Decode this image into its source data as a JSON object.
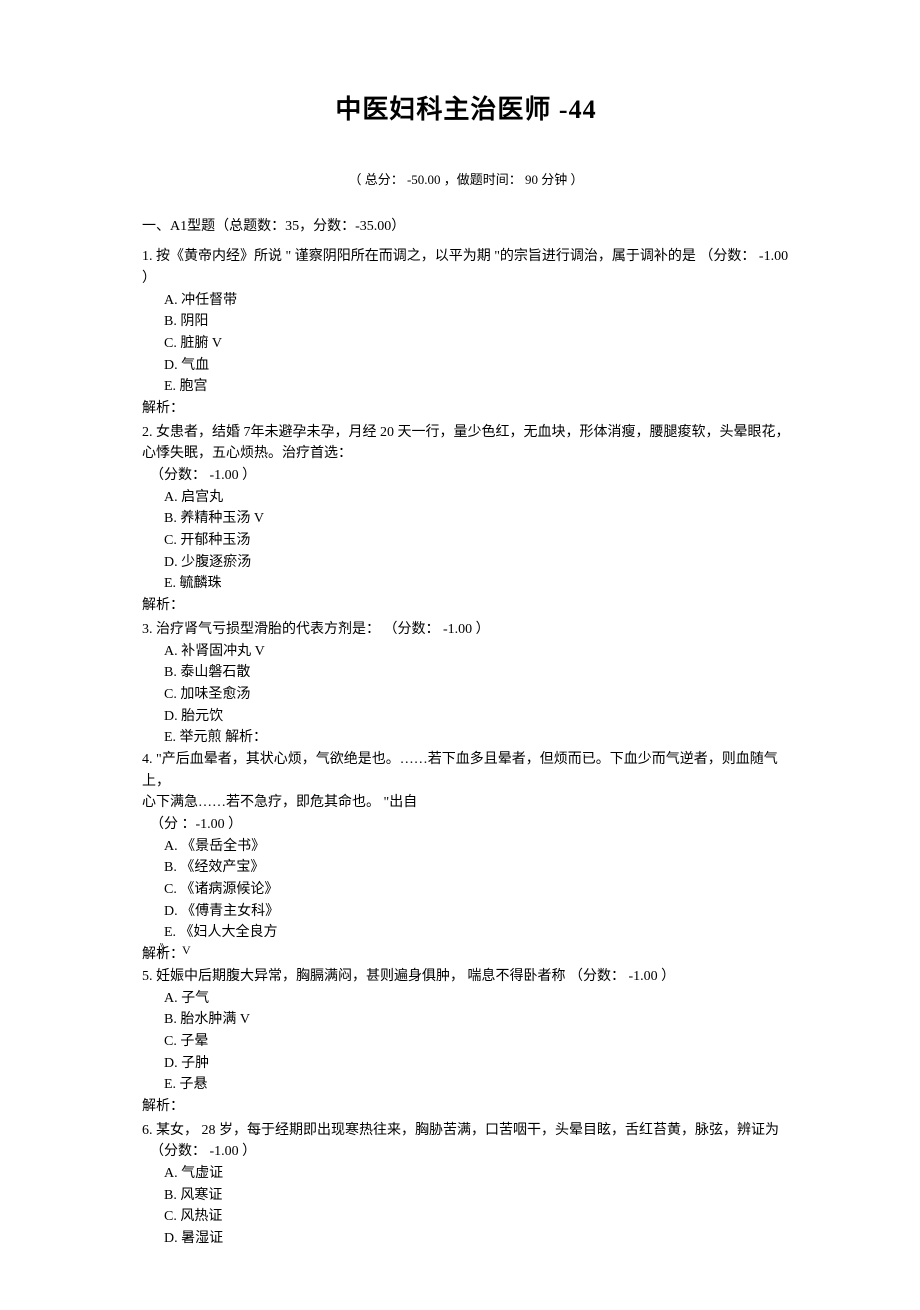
{
  "title": "中医妇科主治医师  -44",
  "meta": "（ 总分：  -50.00 ，做题时间：  90 分钟  ）",
  "section": "一、A1型题（总题数：35，分数：-35.00）",
  "analysis_label": "解析：",
  "analysis_inline": "解析：",
  "q1": {
    "stem": "1.    按《黄帝内经》所说 \" 谨察阴阳所在而调之，以平为期 \"的宗旨进行调治，属于调补的是  （分数：  -1.00 ）",
    "A": "A.  冲任督带",
    "B": "B.  阴阳",
    "C": "C.  脏腑  V",
    "D": "D.  气血",
    "E": "E.  胞宫"
  },
  "q2": {
    "stem1": "2.  女患者，结婚  7年未避孕未孕，月经  20 天一行，量少色红，无血块，形体消瘦，腰腿痠软，头晕眼花，",
    "stem2": "心悸失眠，五心烦热。治疗首选：",
    "score": "（分数：  -1.00 ）",
    "A": "A.  启宫丸",
    "B": "B.  养精种玉汤  V",
    "C": "C.  开郁种玉汤",
    "D": "D.  少腹逐瘀汤",
    "E": "E.  毓麟珠"
  },
  "q3": {
    "stem": "3.  治疗肾气亏损型滑胎的代表方剂是：  （分数：  -1.00 ）",
    "A": "A.  补肾固冲丸  V",
    "B": "B.  泰山磐石散",
    "C": "C.  加味圣愈汤",
    "D": "D.  胎元饮",
    "E": "E.  举元煎"
  },
  "q4": {
    "stem1": "4.  \"产后血晕者，其状心烦，气欲绝是也。……若下血多且晕者，但烦而已。下血少而气逆者，则血随气上，",
    "stem2": "心下满急……若不急疗，即危其命也。    \"出自",
    "score": "（分    ：-1.00 ）",
    "A": "A. 《景岳全书》",
    "B": "B. 《经效产宝》",
    "C": "C. 《诸病源候论》",
    "D": "D. 《傅青主女科》",
    "E": "E. 《妇人大全良方",
    "closeq": "》",
    "mark": "V"
  },
  "q5": {
    "stem": "5.  妊娠中后期腹大异常，胸膈满闷，甚则遍身俱肿，  喘息不得卧者称  （分数：  -1.00 ）",
    "A": "A.  子气",
    "B": "B.  胎水肿满  V",
    "C": "C.  子晕",
    "D": "D.  子肿",
    "E": "E.  子悬"
  },
  "q6": {
    "stem": "6.  某女，   28 岁，每于经期即出现寒热往来，胸胁苦满，口苦咽干，头晕目眩，舌红苔黄，脉弦，辨证为",
    "score": "（分数：  -1.00 ）",
    "A": "A.  气虚证",
    "B": "B.  风寒证",
    "C": "C.  风热证",
    "D": "D.  暑湿证"
  }
}
